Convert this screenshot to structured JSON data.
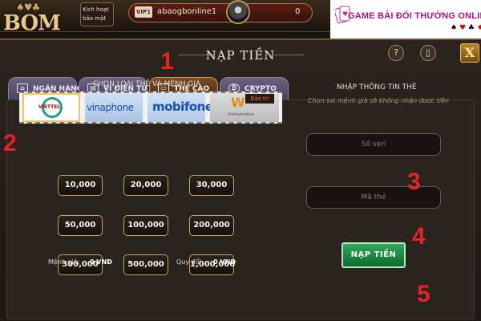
{
  "header": {
    "logo": "BOM",
    "activate_label": "Kích hoạt bảo mật",
    "vip": "VIP1",
    "username": "abaogbonline1",
    "balance": "0"
  },
  "watermark": {
    "title": "GAME BÀI ĐỔI THƯỞNG ONLINE",
    "suits": [
      "♠",
      "♥",
      "♣",
      "♦"
    ]
  },
  "dialog": {
    "title": "NẠP TIỀN",
    "help": "?",
    "close": "X"
  },
  "tabs": [
    {
      "label": "NGÂN HÀNG",
      "icon": "bank-icon",
      "active": false
    },
    {
      "label": "VÍ ĐIỆN TỬ",
      "icon": "wallet-icon",
      "active": false
    },
    {
      "label": "THẺ CÀO",
      "icon": "card-icon",
      "active": true
    },
    {
      "label": "CRYPTO",
      "icon": "bitcoin-icon",
      "active": false
    }
  ],
  "left": {
    "title": "CHỌN LOẠI THẺ VÀ MỆNH GIÁ"
  },
  "carriers": [
    {
      "name": "VIETTEL",
      "selected": true
    },
    {
      "name": "vinaphone",
      "selected": false
    },
    {
      "name": "mobifone",
      "selected": false
    },
    {
      "name": "Vietnamobile",
      "badge": "Bảo trì",
      "selected": false
    }
  ],
  "amounts": [
    "10,000",
    "20,000",
    "30,000",
    "50,000",
    "100,000",
    "200,000",
    "300,000",
    "500,000",
    "1,000,000"
  ],
  "right": {
    "title": "NHẬP THÔNG TIN THẺ",
    "hint": "Chọn sai mệnh giá sẽ không nhận được tiền",
    "serial_placeholder": "Số seri",
    "code_placeholder": "Mã thẻ",
    "submit_label": "NẠP TIỀN"
  },
  "summary": {
    "face_label": "Mệnh giá:",
    "face_value": "0 VNĐ",
    "convert_label": "Quy đổi:",
    "convert_value": "0 VNĐ"
  },
  "annotations": [
    "1",
    "2",
    "3",
    "4",
    "5"
  ],
  "colors": {
    "annotation": "#e8202a",
    "active_tab": "#7a4a2a",
    "submit": "#1f8a46",
    "amount_border": "#c9a45e"
  }
}
